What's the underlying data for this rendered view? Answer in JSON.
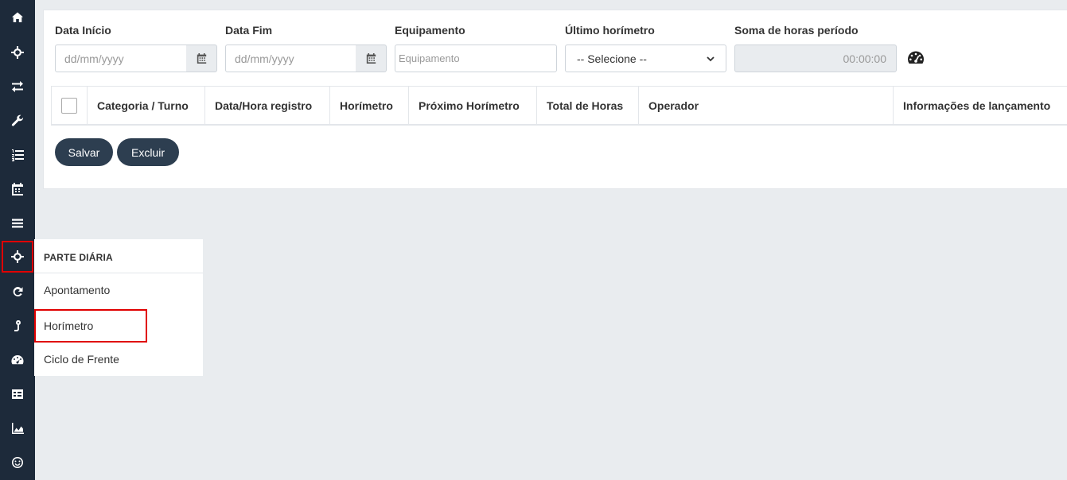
{
  "sidebar": {
    "icons": [
      {
        "name": "home-icon"
      },
      {
        "name": "crosshair-icon"
      },
      {
        "name": "exchange-icon"
      },
      {
        "name": "wrench-icon"
      },
      {
        "name": "list-ol-icon"
      },
      {
        "name": "calendar-icon"
      },
      {
        "name": "bars-icon"
      },
      {
        "name": "crosshair-icon",
        "active": true
      },
      {
        "name": "redo-icon"
      },
      {
        "name": "pin-icon"
      },
      {
        "name": "dashboard-icon"
      },
      {
        "name": "table-icon"
      },
      {
        "name": "area-chart-icon"
      },
      {
        "name": "smile-icon"
      }
    ],
    "highlight_color": "#e00000"
  },
  "filters": {
    "data_inicio": {
      "label": "Data Início",
      "placeholder": "dd/mm/yyyy"
    },
    "data_fim": {
      "label": "Data Fim",
      "placeholder": "dd/mm/yyyy"
    },
    "equipamento": {
      "label": "Equipamento",
      "placeholder": "Equipamento"
    },
    "ultimo_horimetro": {
      "label": "Último horímetro",
      "selected": "-- Selecione --"
    },
    "soma_horas": {
      "label": "Soma de horas período",
      "value": "00:00:00"
    }
  },
  "table": {
    "columns": [
      "Categoria / Turno",
      "Data/Hora registro",
      "Horímetro",
      "Próximo Horímetro",
      "Total de Horas",
      "Operador",
      "Informações de lançamento"
    ]
  },
  "actions": {
    "save_label": "Salvar",
    "delete_label": "Excluir"
  },
  "flyout": {
    "title": "PARTE DIÁRIA",
    "items": [
      "Apontamento",
      "Horímetro",
      "Ciclo de Frente"
    ]
  },
  "colors": {
    "sidebar_bg": "#1d2a3a",
    "button_bg": "#2d3e50",
    "highlight": "#e00000"
  }
}
